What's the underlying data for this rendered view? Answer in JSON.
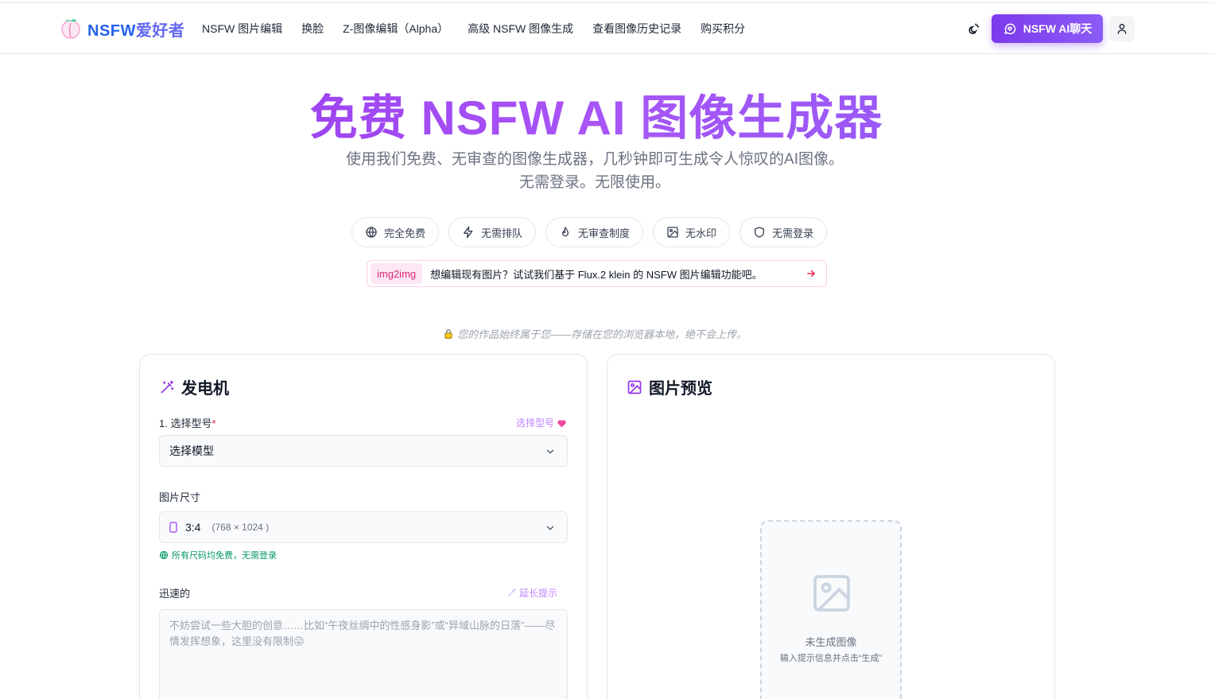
{
  "header": {
    "logo_text_a": "NSFW",
    "logo_text_b": "爱好者",
    "nav": [
      "NSFW 图片编辑",
      "换脸",
      "Z-图像编辑（Alpha）",
      "高级 NSFW 图像生成",
      "查看图像历史记录",
      "购买积分"
    ],
    "chat_button": "NSFW AI聊天"
  },
  "hero": {
    "title": "免费 NSFW AI 图像生成器",
    "subtitle_line1": "使用我们免费、无审查的图像生成器，几秒钟即可生成令人惊叹的AI图像。",
    "subtitle_line2": "无需登录。无限使用。"
  },
  "pills": [
    "完全免费",
    "无需排队",
    "无审查制度",
    "无水印",
    "无需登录"
  ],
  "promo": {
    "tag": "img2img",
    "text": "想编辑现有图片？试试我们基于 Flux.2 klein 的 NSFW 图片编辑功能吧。"
  },
  "privacy_note": "您的作品始终属于您——存储在您的浏览器本地，绝不会上传。",
  "generator": {
    "title": "发电机",
    "model_label": "1. 选择型号",
    "model_required": "*",
    "model_link": "选择型号",
    "model_value": "选择模型",
    "size_label": "图片尺寸",
    "size_value": "3:4",
    "size_dims": "(768 × 1024 )",
    "size_hint": "所有尺码均免费，无需登录",
    "prompt_label": "迅速的",
    "prompt_link": "延长提示",
    "prompt_placeholder": "不妨尝试一些大胆的创意……比如“午夜丝绸中的性感身影”或“异域山脉的日落”——尽情发挥想象，这里没有限制😛"
  },
  "preview": {
    "title": "图片预览",
    "empty_title": "未生成图像",
    "empty_sub": "输入提示信息并点击“生成”"
  },
  "colors": {
    "accent": "#7c3aed",
    "pink": "#db2777",
    "green": "#059669"
  }
}
